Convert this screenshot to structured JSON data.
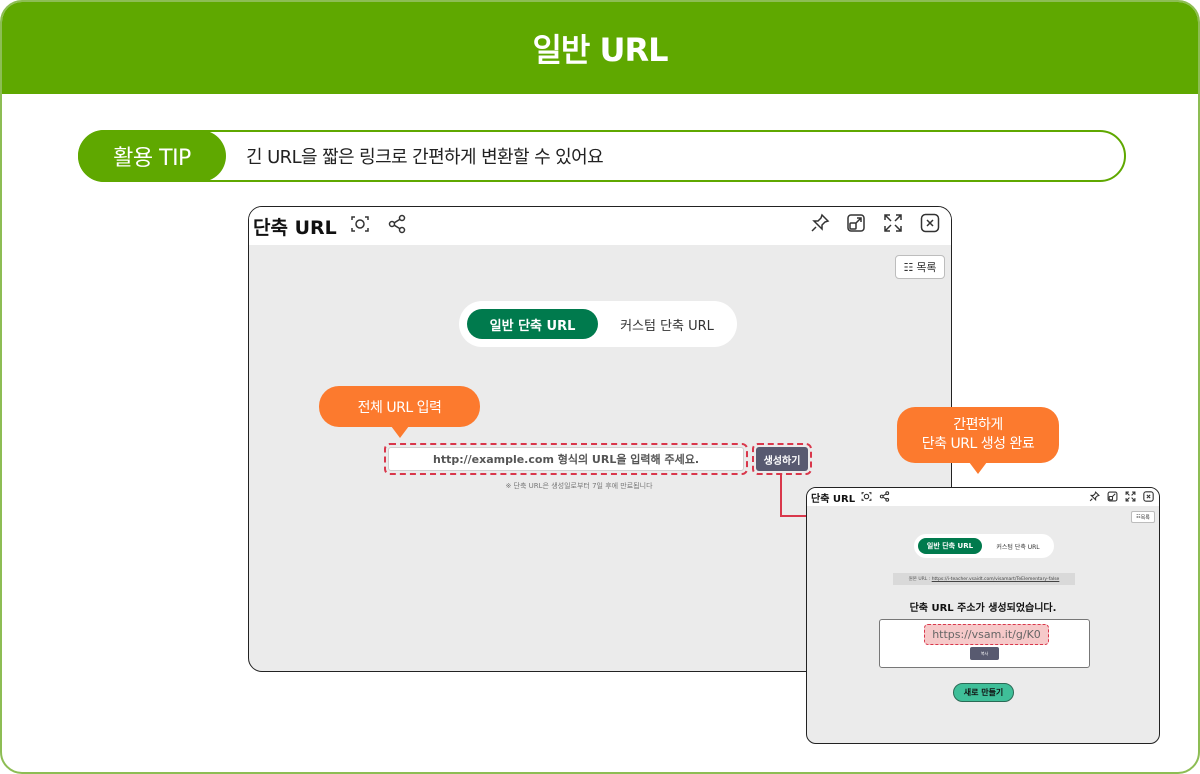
{
  "header": {
    "title": "일반 URL"
  },
  "tip": {
    "label": "활용 TIP",
    "text": "긴 URL을 짧은 링크로 간편하게 변환할 수 있어요"
  },
  "main_window": {
    "title": "단축 URL",
    "list_button": "목록",
    "tabs": [
      {
        "label": "일반 단축 URL",
        "active": true
      },
      {
        "label": "커스텀 단축 URL",
        "active": false
      }
    ],
    "input_placeholder": "http://example.com 형식의 URL을 입력해 주세요.",
    "generate_button": "생성하기",
    "note": "※ 단축 URL은 생성일로부터 7일 후에 만료됩니다"
  },
  "callouts": {
    "input": "전체 URL 입력",
    "done_line1": "간편하게",
    "done_line2": "단축 URL 생성 완료"
  },
  "result_window": {
    "title": "단축 URL",
    "list_button": "목록",
    "tabs": [
      {
        "label": "일반 단축 URL",
        "active": true
      },
      {
        "label": "커스텀 단축 URL",
        "active": false
      }
    ],
    "original_label": "원본 URL :",
    "original_url": "https://i-teacher.vsaidt.com/visamart/TeElementary-false",
    "done_message": "단축 URL 주소가 생성되었습니다.",
    "short_url": "https://vsam.it/g/K0",
    "copy_button": "복사",
    "new_button": "새로 만들기"
  },
  "colors": {
    "brand_green": "#5fa800",
    "tab_green": "#007a4d",
    "callout_orange": "#fc7a2e",
    "highlight_red": "#d9374b",
    "new_button": "#3fbf99"
  },
  "icons": [
    "capture-icon",
    "share-icon",
    "pin-icon",
    "popout-icon",
    "expand-icon",
    "close-icon",
    "list-icon"
  ]
}
